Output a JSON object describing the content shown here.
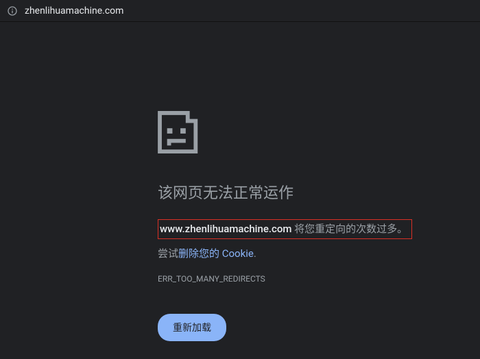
{
  "address_bar": {
    "url": "zhenlihuamachine.com"
  },
  "error": {
    "heading": "该网页无法正常运作",
    "domain_bold": "www.zhenlihuamachine.com",
    "message_suffix": " 将您重定向的次数过多。",
    "suggestion_prefix": "尝试",
    "suggestion_link": "删除您的 Cookie",
    "suggestion_suffix": ".",
    "error_code": "ERR_TOO_MANY_REDIRECTS",
    "reload_button": "重新加载"
  }
}
